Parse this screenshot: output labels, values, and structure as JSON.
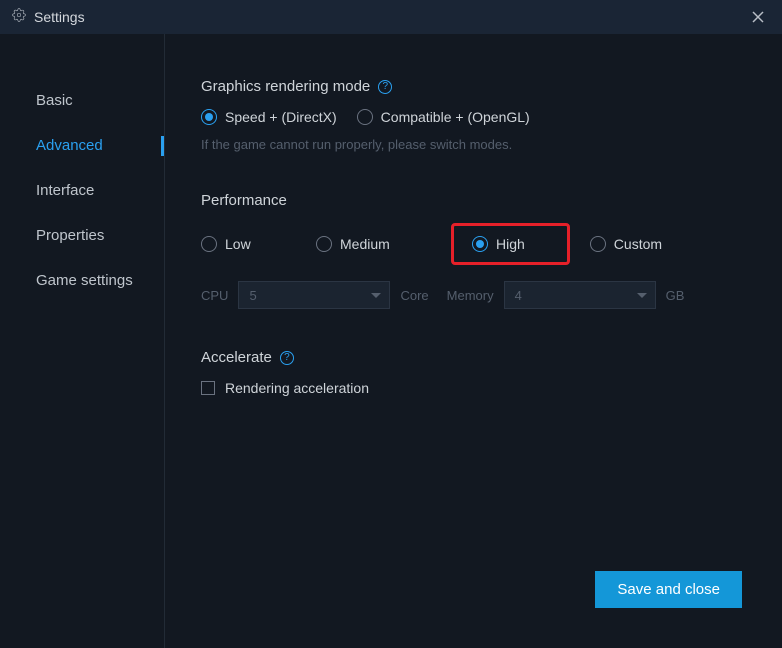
{
  "titlebar": {
    "title": "Settings"
  },
  "sidebar": {
    "items": [
      {
        "label": "Basic",
        "active": false
      },
      {
        "label": "Advanced",
        "active": true
      },
      {
        "label": "Interface",
        "active": false
      },
      {
        "label": "Properties",
        "active": false
      },
      {
        "label": "Game settings",
        "active": false
      }
    ]
  },
  "graphics": {
    "title": "Graphics rendering mode",
    "options": [
      {
        "label": "Speed + (DirectX)",
        "checked": true
      },
      {
        "label": "Compatible + (OpenGL)",
        "checked": false
      }
    ],
    "hint": "If the game cannot run properly, please switch modes."
  },
  "performance": {
    "title": "Performance",
    "options": [
      {
        "label": "Low",
        "checked": false
      },
      {
        "label": "Medium",
        "checked": false
      },
      {
        "label": "High",
        "checked": true
      },
      {
        "label": "Custom",
        "checked": false
      }
    ],
    "cpu_label": "CPU",
    "cpu_value": "5",
    "cpu_unit": "Core",
    "memory_label": "Memory",
    "memory_value": "4",
    "memory_unit": "GB"
  },
  "accelerate": {
    "title": "Accelerate",
    "checkbox_label": "Rendering acceleration",
    "checked": false
  },
  "footer": {
    "save_label": "Save and close"
  }
}
